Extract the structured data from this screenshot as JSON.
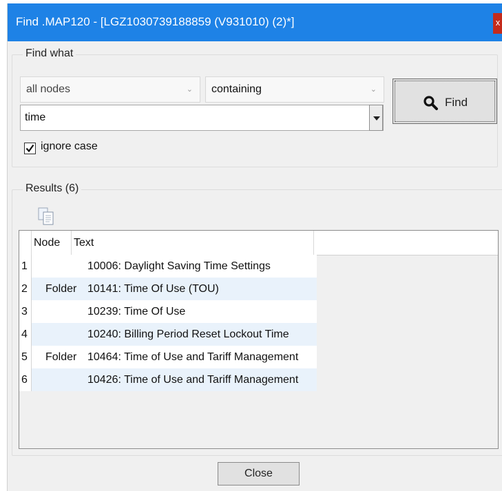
{
  "window": {
    "title": "Find .MAP120 - [LGZ1030739188859 (V931010) (2)*]",
    "close_glyph": "x",
    "accent_color": "#1e82e6"
  },
  "find_what": {
    "group_label": "Find what",
    "scope_select": "all nodes",
    "match_select": "containing",
    "search_value": "time",
    "find_button_label": "Find",
    "find_button_icon": "search-icon",
    "ignore_case_label": "ignore case",
    "ignore_case_checked": true
  },
  "results": {
    "group_label": "Results (6)",
    "copy_icon": "copy-icon",
    "columns": [
      "Node",
      "Text"
    ],
    "rows": [
      {
        "num": "1",
        "node": "",
        "text": "10006: Daylight Saving Time Settings"
      },
      {
        "num": "2",
        "node": "Folder",
        "text": "10141: Time Of Use (TOU)"
      },
      {
        "num": "3",
        "node": "",
        "text": "10239: Time Of Use"
      },
      {
        "num": "4",
        "node": "",
        "text": "10240: Billing Period Reset Lockout Time"
      },
      {
        "num": "5",
        "node": "Folder",
        "text": "10464: Time of Use and Tariff Management"
      },
      {
        "num": "6",
        "node": "",
        "text": "10426: Time of Use and Tariff Management"
      }
    ]
  },
  "footer": {
    "close_label": "Close"
  }
}
